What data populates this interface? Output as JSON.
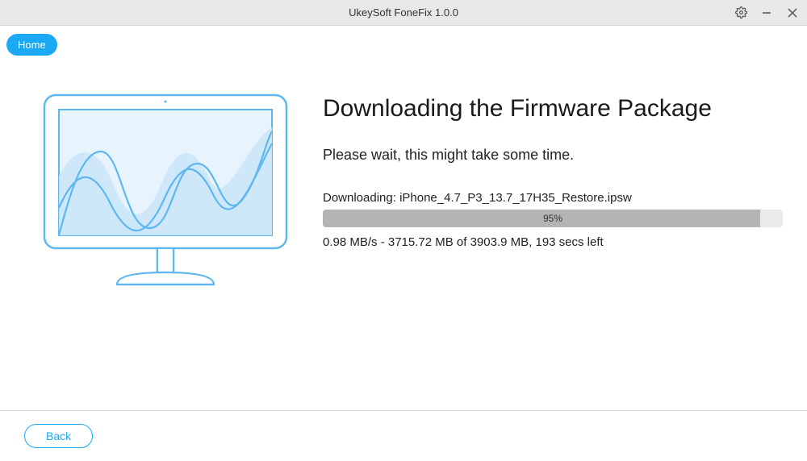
{
  "titlebar": {
    "title": "UkeySoft FoneFix 1.0.0"
  },
  "nav": {
    "home_label": "Home"
  },
  "page": {
    "title": "Downloading the Firmware Package",
    "wait_message": "Please wait, this might take some time.",
    "downloading_prefix": "Downloading: ",
    "filename": "iPhone_4.7_P3_13.7_17H35_Restore.ipsw",
    "progress_percent": 95,
    "progress_label": "95%",
    "stats": "0.98 MB/s - 3715.72 MB of 3903.9 MB, 193 secs left"
  },
  "footer": {
    "back_label": "Back"
  }
}
